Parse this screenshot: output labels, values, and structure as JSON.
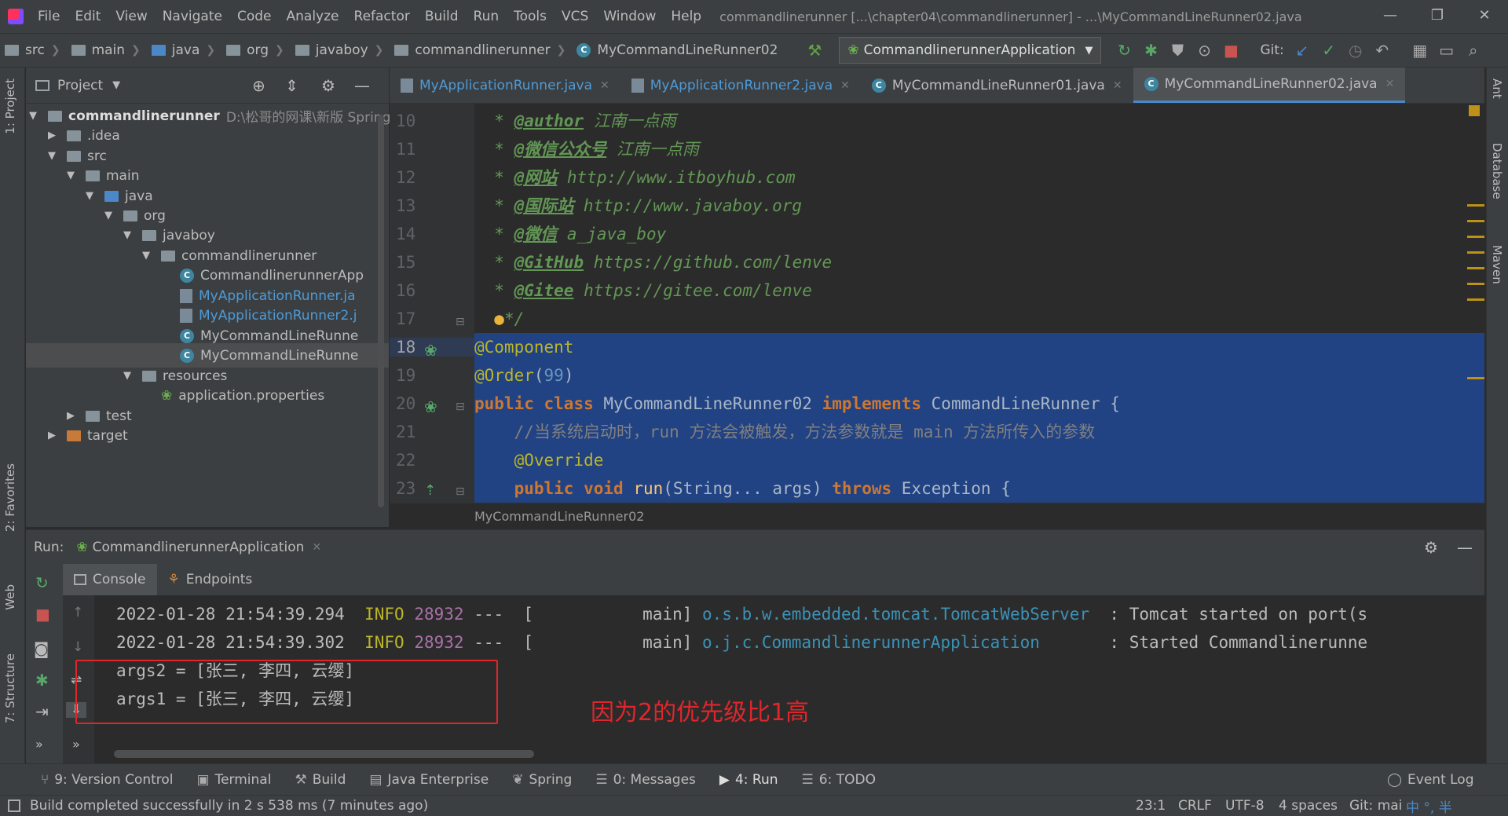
{
  "menu": {
    "items": [
      "File",
      "Edit",
      "View",
      "Navigate",
      "Code",
      "Analyze",
      "Refactor",
      "Build",
      "Run",
      "Tools",
      "VCS",
      "Window",
      "Help"
    ],
    "title": "commandlinerunner [...\\chapter04\\commandlinerunner] - ...\\MyCommandLineRunner02.java",
    "minimize": "—",
    "restore": "❐",
    "close": "✕"
  },
  "nav": {
    "crumbs": [
      "src",
      "main",
      "java",
      "org",
      "javaboy",
      "commandlinerunner",
      "MyCommandLineRunner02"
    ],
    "run_config": "CommandlinerunnerApplication",
    "git_label": "Git:"
  },
  "left_stripe": {
    "project": "1: Project",
    "favorites": "2: Favorites",
    "web": "Web",
    "structure": "7: Structure"
  },
  "right_stripe": {
    "ant": "Ant",
    "database": "Database",
    "maven": "Maven"
  },
  "project": {
    "title": "Project",
    "tree": [
      {
        "label": "commandlinerunner",
        "suffix": "D:\\松哥的网课\\新版 Spring B",
        "bold": true
      },
      {
        "label": ".idea"
      },
      {
        "label": "src"
      },
      {
        "label": "main"
      },
      {
        "label": "java"
      },
      {
        "label": "org"
      },
      {
        "label": "javaboy"
      },
      {
        "label": "commandlinerunner"
      },
      {
        "label": "CommandlinerunnerApp"
      },
      {
        "label": "MyApplicationRunner.ja"
      },
      {
        "label": "MyApplicationRunner2.j"
      },
      {
        "label": "MyCommandLineRunne"
      },
      {
        "label": "MyCommandLineRunne"
      },
      {
        "label": "resources"
      },
      {
        "label": "application.properties"
      },
      {
        "label": "test"
      },
      {
        "label": "target"
      }
    ]
  },
  "editor": {
    "tabs": [
      "MyApplicationRunner.java",
      "MyApplicationRunner2.java",
      "MyCommandLineRunner01.java",
      "MyCommandLineRunner02.java"
    ],
    "line_numbers": [
      "10",
      "11",
      "12",
      "13",
      "14",
      "15",
      "16",
      "17",
      "18",
      "19",
      "20",
      "21",
      "22",
      "23"
    ],
    "doc_tags": [
      "@author",
      "@微信公众号",
      "@网站",
      "@国际站",
      "@微信",
      "@GitHub",
      "@Gitee"
    ],
    "doc_values": [
      "江南一点雨",
      "江南一点雨",
      "http://www.itboyhub.com",
      "http://www.javaboy.org",
      "a_java_boy",
      "https://github.com/lenve",
      "https://gitee.com/lenve"
    ],
    "doc_end": "*/",
    "ann_component": "@Component",
    "ann_order": "@Order",
    "order_value": "99",
    "kw_public": "public",
    "kw_class": "class",
    "class_name": "MyCommandLineRunner02",
    "kw_implements": "implements",
    "iface": "CommandLineRunner",
    "brace": "{",
    "comment": "//当系统启动时，run 方法会被触发，方法参数就是 main 方法所传入的参数",
    "ann_override": "@Override",
    "kw_void": "void",
    "method": "run",
    "param_type": "String...",
    "param": "args",
    "kw_throws": "throws",
    "exception": "Exception",
    "breadcrumb": "MyCommandLineRunner02"
  },
  "run": {
    "label": "Run:",
    "config": "CommandlinerunnerApplication",
    "tabs": [
      "Console",
      "Endpoints"
    ],
    "log_lines": [
      {
        "time": "2022-01-28 21:54:39.294",
        "level": "INFO",
        "pid": "28932",
        "thread": "---  [           main]",
        "logger": "o.s.b.w.embedded.tomcat.TomcatWebServer",
        "msg": ": Tomcat started on port(s"
      },
      {
        "time": "2022-01-28 21:54:39.302",
        "level": "INFO",
        "pid": "28932",
        "thread": "---  [           main]",
        "logger": "o.j.c.CommandlinerunnerApplication",
        "msg": ": Started Commandlinerunne"
      }
    ],
    "outputs": [
      "args2 = [张三, 李四, 云缨]",
      "args1 = [张三, 李四, 云缨]"
    ],
    "annotation": "因为2的优先级比1高"
  },
  "toolwindows": [
    "9: Version Control",
    "Terminal",
    "Build",
    "Java Enterprise",
    "Spring",
    "0: Messages",
    "4: Run",
    "6: TODO"
  ],
  "event_log": "Event Log",
  "status": {
    "message": "Build completed successfully in 2 s 538 ms (7 minutes ago)",
    "position": "23:1",
    "line_sep": "CRLF",
    "encoding": "UTF-8",
    "indent": "4 spaces",
    "git": "Git: mai",
    "ime": "中 °, 半"
  },
  "colors": {
    "selection": "#214283",
    "annotation_red": "#e0262b",
    "accent": "#4a88c7"
  }
}
